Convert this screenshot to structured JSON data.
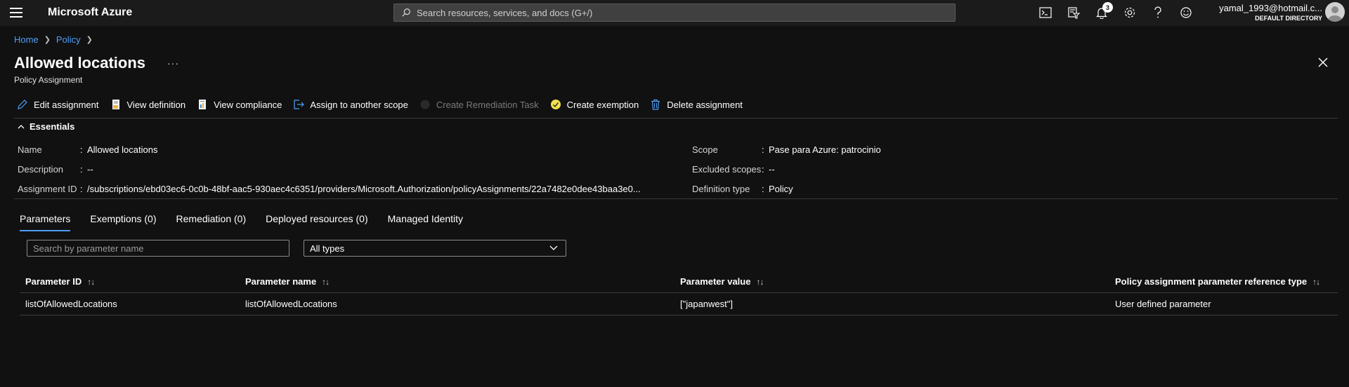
{
  "topbar": {
    "brand": "Microsoft Azure",
    "search_placeholder": "Search resources, services, and docs (G+/)",
    "notification_count": "3",
    "user": "yamal_1993@hotmail.c...",
    "directory": "DEFAULT DIRECTORY",
    "icons": [
      "cloud-shell-icon",
      "directory-filter-icon",
      "bell-icon",
      "gear-icon",
      "help-icon",
      "feedback-icon"
    ]
  },
  "breadcrumb": {
    "home": "Home",
    "policy": "Policy"
  },
  "page": {
    "title": "Allowed locations",
    "more": "···",
    "subtitle": "Policy Assignment"
  },
  "toolbar": {
    "edit": "Edit assignment",
    "view_definition": "View definition",
    "view_compliance": "View compliance",
    "assign_scope": "Assign to another scope",
    "create_remediation": "Create Remediation Task",
    "create_exemption": "Create exemption",
    "delete": "Delete assignment"
  },
  "essentials": {
    "header": "Essentials",
    "name_label": "Name",
    "name_value": "Allowed locations",
    "description_label": "Description",
    "description_value": "--",
    "assignment_id_label": "Assignment ID",
    "assignment_id_value": "/subscriptions/ebd03ec6-0c0b-48bf-aac5-930aec4c6351/providers/Microsoft.Authorization/policyAssignments/22a7482e0dee43baa3e0...",
    "scope_label": "Scope",
    "scope_value": "Pase para Azure: patrocinio",
    "excluded_label": "Excluded scopes",
    "excluded_value": "--",
    "deftype_label": "Definition type",
    "deftype_value": "Policy",
    "colon": ":"
  },
  "tabs": [
    "Parameters",
    "Exemptions (0)",
    "Remediation (0)",
    "Deployed resources (0)",
    "Managed Identity"
  ],
  "filters": {
    "search_placeholder": "Search by parameter name",
    "type_value": "All types"
  },
  "table": {
    "headers": [
      "Parameter ID",
      "Parameter name",
      "Parameter value",
      "Policy assignment parameter reference type"
    ],
    "sort_glyph": "↑↓",
    "rows": [
      [
        "listOfAllowedLocations",
        "listOfAllowedLocations",
        "[\"japanwest\"]",
        "User defined parameter"
      ]
    ]
  },
  "colors": {
    "accent": "#4f9ef8",
    "background": "#111111",
    "topbar": "#1b1b1b"
  }
}
